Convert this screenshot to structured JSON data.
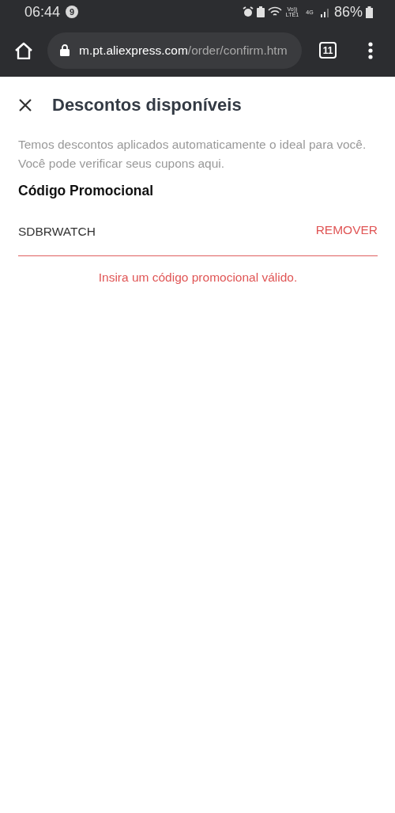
{
  "status_bar": {
    "time": "06:44",
    "notification_count": "9",
    "volte_label": "Vo)) LTE1",
    "network_type": "4G",
    "battery": "86%"
  },
  "browser": {
    "url_host": "m.pt.aliexpress.com",
    "url_path": "/order/confirm.htm",
    "tab_count": "11"
  },
  "dialog": {
    "title": "Descontos disponíveis",
    "description": "Temos descontos aplicados automaticamente o ideal para você. Você pode verificar seus cupons aqui.",
    "section_title": "Código Promocional",
    "promo_field": {
      "value": "SDBRWATCH",
      "action": "REMOVER",
      "invalid": true,
      "error_message": "Insira um código promocional válido."
    }
  }
}
